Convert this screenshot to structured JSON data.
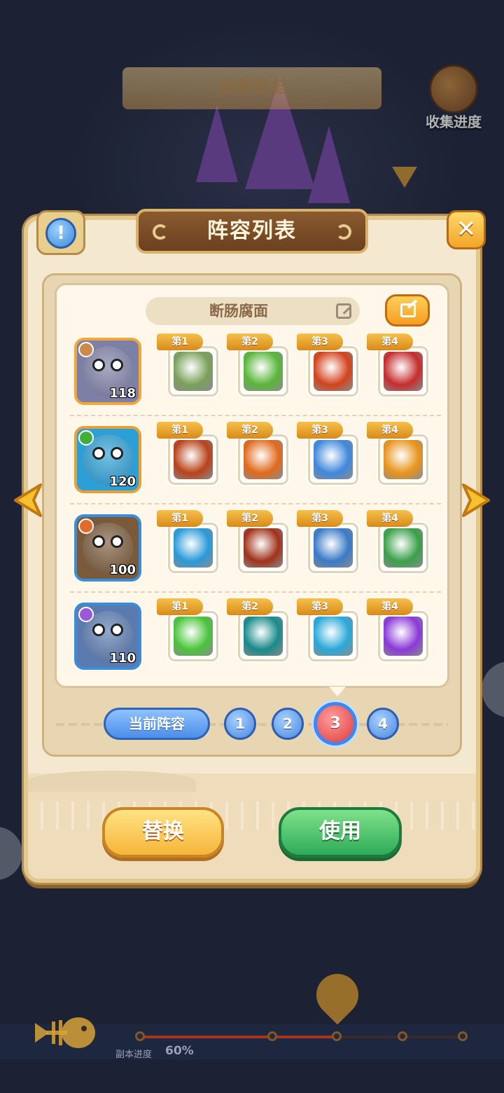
{
  "background": {
    "stage_title": "极寒堡垒",
    "collect_label": "收集进度",
    "progress_label": "副本进度",
    "progress_value": "60%",
    "progress_fraction": 0.6
  },
  "dialog": {
    "title": "阵容列表",
    "lineup_name": "断肠腐面",
    "info_icon_glyph": "!",
    "close_icon_glyph": "✕"
  },
  "lineup": [
    {
      "level": "118",
      "hero_color": "#7d7fa6",
      "frame_color": "#f0a63a",
      "element_color": "#c98a4a",
      "skills": [
        {
          "label": "第1",
          "icon": "spiked-mace-icon",
          "color": "#7aa05a"
        },
        {
          "label": "第2",
          "icon": "gold-shield-icon",
          "color": "#5ab53a"
        },
        {
          "label": "第3",
          "icon": "flame-face-icon",
          "color": "#d2431c"
        },
        {
          "label": "第4",
          "icon": "axe-icon",
          "color": "#c52d2d"
        }
      ]
    },
    {
      "level": "120",
      "hero_color": "#2c9fd6",
      "frame_color": "#e7a033",
      "element_color": "#3fae3a",
      "skills": [
        {
          "label": "第1",
          "icon": "eye-orb-icon",
          "color": "#b8421a"
        },
        {
          "label": "第2",
          "icon": "campfire-icon",
          "color": "#e06a1c"
        },
        {
          "label": "第3",
          "icon": "ghost-splash-icon",
          "color": "#3f88dc"
        },
        {
          "label": "第4",
          "icon": "dragon-fire-icon",
          "color": "#e8951c"
        }
      ]
    },
    {
      "level": "100",
      "hero_color": "#7a5a3a",
      "frame_color": "#3a8ed8",
      "element_color": "#e26a2a",
      "skills": [
        {
          "label": "第1",
          "icon": "green-crystal-icon",
          "color": "#2a9ad8"
        },
        {
          "label": "第2",
          "icon": "dark-orb-icon",
          "color": "#a0321a"
        },
        {
          "label": "第3",
          "icon": "stone-golem-icon",
          "color": "#3a7ac8"
        },
        {
          "label": "第4",
          "icon": "flower-bud-icon",
          "color": "#3aa04a"
        }
      ]
    },
    {
      "level": "110",
      "hero_color": "#5a7ab0",
      "frame_color": "#3a8ed8",
      "element_color": "#9a5ad8",
      "skills": [
        {
          "label": "第1",
          "icon": "green-burst-icon",
          "color": "#4ac43a"
        },
        {
          "label": "第2",
          "icon": "red-mask-icon",
          "color": "#1a8a8a"
        },
        {
          "label": "第3",
          "icon": "ice-trident-icon",
          "color": "#2aa8d8"
        },
        {
          "label": "第4",
          "icon": "purple-rune-icon",
          "color": "#8a3ad8"
        }
      ]
    }
  ],
  "lineup_selector": {
    "current_label": "当前阵容",
    "slots": [
      "1",
      "2",
      "3",
      "4"
    ],
    "active_slot": "3"
  },
  "actions": {
    "replace_label": "替换",
    "use_label": "使用"
  }
}
